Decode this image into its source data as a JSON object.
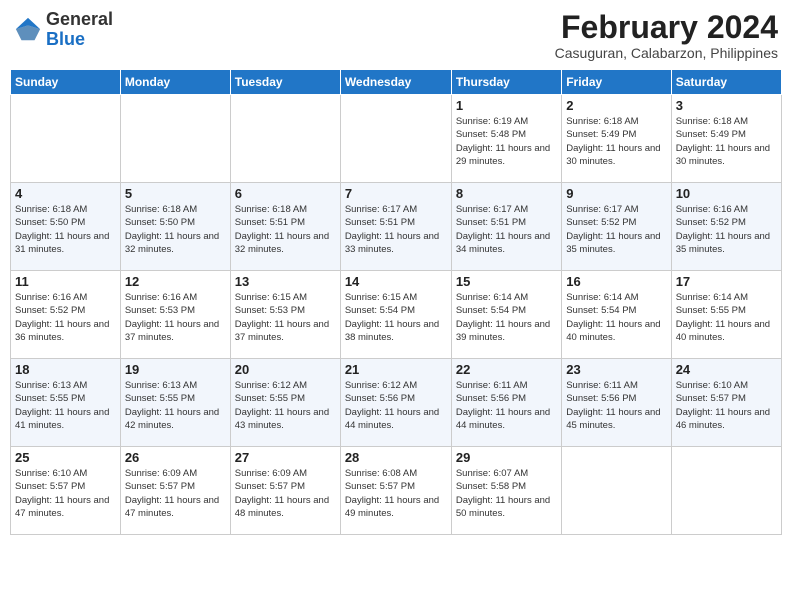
{
  "header": {
    "logo_general": "General",
    "logo_blue": "Blue",
    "month_year": "February 2024",
    "location": "Casuguran, Calabarzon, Philippines"
  },
  "weekdays": [
    "Sunday",
    "Monday",
    "Tuesday",
    "Wednesday",
    "Thursday",
    "Friday",
    "Saturday"
  ],
  "weeks": [
    [
      {
        "day": "",
        "sunrise": "",
        "sunset": "",
        "daylight": ""
      },
      {
        "day": "",
        "sunrise": "",
        "sunset": "",
        "daylight": ""
      },
      {
        "day": "",
        "sunrise": "",
        "sunset": "",
        "daylight": ""
      },
      {
        "day": "",
        "sunrise": "",
        "sunset": "",
        "daylight": ""
      },
      {
        "day": "1",
        "sunrise": "Sunrise: 6:19 AM",
        "sunset": "Sunset: 5:48 PM",
        "daylight": "Daylight: 11 hours and 29 minutes."
      },
      {
        "day": "2",
        "sunrise": "Sunrise: 6:18 AM",
        "sunset": "Sunset: 5:49 PM",
        "daylight": "Daylight: 11 hours and 30 minutes."
      },
      {
        "day": "3",
        "sunrise": "Sunrise: 6:18 AM",
        "sunset": "Sunset: 5:49 PM",
        "daylight": "Daylight: 11 hours and 30 minutes."
      }
    ],
    [
      {
        "day": "4",
        "sunrise": "Sunrise: 6:18 AM",
        "sunset": "Sunset: 5:50 PM",
        "daylight": "Daylight: 11 hours and 31 minutes."
      },
      {
        "day": "5",
        "sunrise": "Sunrise: 6:18 AM",
        "sunset": "Sunset: 5:50 PM",
        "daylight": "Daylight: 11 hours and 32 minutes."
      },
      {
        "day": "6",
        "sunrise": "Sunrise: 6:18 AM",
        "sunset": "Sunset: 5:51 PM",
        "daylight": "Daylight: 11 hours and 32 minutes."
      },
      {
        "day": "7",
        "sunrise": "Sunrise: 6:17 AM",
        "sunset": "Sunset: 5:51 PM",
        "daylight": "Daylight: 11 hours and 33 minutes."
      },
      {
        "day": "8",
        "sunrise": "Sunrise: 6:17 AM",
        "sunset": "Sunset: 5:51 PM",
        "daylight": "Daylight: 11 hours and 34 minutes."
      },
      {
        "day": "9",
        "sunrise": "Sunrise: 6:17 AM",
        "sunset": "Sunset: 5:52 PM",
        "daylight": "Daylight: 11 hours and 35 minutes."
      },
      {
        "day": "10",
        "sunrise": "Sunrise: 6:16 AM",
        "sunset": "Sunset: 5:52 PM",
        "daylight": "Daylight: 11 hours and 35 minutes."
      }
    ],
    [
      {
        "day": "11",
        "sunrise": "Sunrise: 6:16 AM",
        "sunset": "Sunset: 5:52 PM",
        "daylight": "Daylight: 11 hours and 36 minutes."
      },
      {
        "day": "12",
        "sunrise": "Sunrise: 6:16 AM",
        "sunset": "Sunset: 5:53 PM",
        "daylight": "Daylight: 11 hours and 37 minutes."
      },
      {
        "day": "13",
        "sunrise": "Sunrise: 6:15 AM",
        "sunset": "Sunset: 5:53 PM",
        "daylight": "Daylight: 11 hours and 37 minutes."
      },
      {
        "day": "14",
        "sunrise": "Sunrise: 6:15 AM",
        "sunset": "Sunset: 5:54 PM",
        "daylight": "Daylight: 11 hours and 38 minutes."
      },
      {
        "day": "15",
        "sunrise": "Sunrise: 6:14 AM",
        "sunset": "Sunset: 5:54 PM",
        "daylight": "Daylight: 11 hours and 39 minutes."
      },
      {
        "day": "16",
        "sunrise": "Sunrise: 6:14 AM",
        "sunset": "Sunset: 5:54 PM",
        "daylight": "Daylight: 11 hours and 40 minutes."
      },
      {
        "day": "17",
        "sunrise": "Sunrise: 6:14 AM",
        "sunset": "Sunset: 5:55 PM",
        "daylight": "Daylight: 11 hours and 40 minutes."
      }
    ],
    [
      {
        "day": "18",
        "sunrise": "Sunrise: 6:13 AM",
        "sunset": "Sunset: 5:55 PM",
        "daylight": "Daylight: 11 hours and 41 minutes."
      },
      {
        "day": "19",
        "sunrise": "Sunrise: 6:13 AM",
        "sunset": "Sunset: 5:55 PM",
        "daylight": "Daylight: 11 hours and 42 minutes."
      },
      {
        "day": "20",
        "sunrise": "Sunrise: 6:12 AM",
        "sunset": "Sunset: 5:55 PM",
        "daylight": "Daylight: 11 hours and 43 minutes."
      },
      {
        "day": "21",
        "sunrise": "Sunrise: 6:12 AM",
        "sunset": "Sunset: 5:56 PM",
        "daylight": "Daylight: 11 hours and 44 minutes."
      },
      {
        "day": "22",
        "sunrise": "Sunrise: 6:11 AM",
        "sunset": "Sunset: 5:56 PM",
        "daylight": "Daylight: 11 hours and 44 minutes."
      },
      {
        "day": "23",
        "sunrise": "Sunrise: 6:11 AM",
        "sunset": "Sunset: 5:56 PM",
        "daylight": "Daylight: 11 hours and 45 minutes."
      },
      {
        "day": "24",
        "sunrise": "Sunrise: 6:10 AM",
        "sunset": "Sunset: 5:57 PM",
        "daylight": "Daylight: 11 hours and 46 minutes."
      }
    ],
    [
      {
        "day": "25",
        "sunrise": "Sunrise: 6:10 AM",
        "sunset": "Sunset: 5:57 PM",
        "daylight": "Daylight: 11 hours and 47 minutes."
      },
      {
        "day": "26",
        "sunrise": "Sunrise: 6:09 AM",
        "sunset": "Sunset: 5:57 PM",
        "daylight": "Daylight: 11 hours and 47 minutes."
      },
      {
        "day": "27",
        "sunrise": "Sunrise: 6:09 AM",
        "sunset": "Sunset: 5:57 PM",
        "daylight": "Daylight: 11 hours and 48 minutes."
      },
      {
        "day": "28",
        "sunrise": "Sunrise: 6:08 AM",
        "sunset": "Sunset: 5:57 PM",
        "daylight": "Daylight: 11 hours and 49 minutes."
      },
      {
        "day": "29",
        "sunrise": "Sunrise: 6:07 AM",
        "sunset": "Sunset: 5:58 PM",
        "daylight": "Daylight: 11 hours and 50 minutes."
      },
      {
        "day": "",
        "sunrise": "",
        "sunset": "",
        "daylight": ""
      },
      {
        "day": "",
        "sunrise": "",
        "sunset": "",
        "daylight": ""
      }
    ]
  ]
}
